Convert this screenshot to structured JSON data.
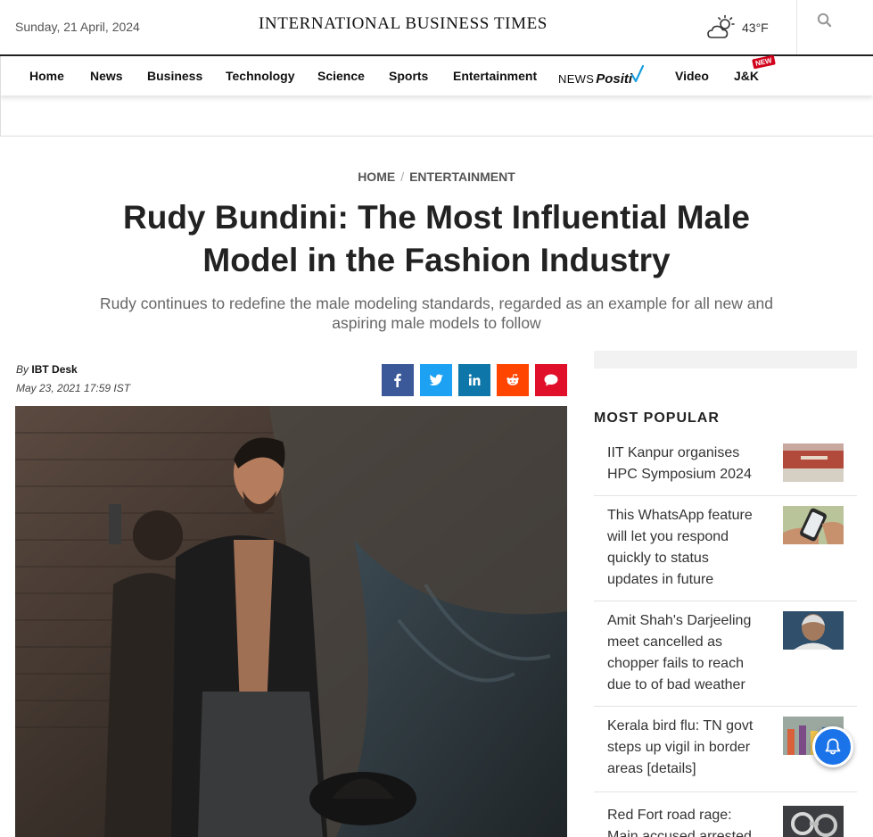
{
  "header": {
    "date": "Sunday, 21 April, 2024",
    "brand": "INTERNATIONAL BUSINESS TIMES",
    "weather_icon": "cloud-sun-icon",
    "temperature": "43°F",
    "search_icon": "search-icon"
  },
  "nav": {
    "items": [
      "Home",
      "News",
      "Business",
      "Technology",
      "Science",
      "Sports",
      "Entertainment"
    ],
    "newspositiv_prefix": "NEWS",
    "newspositiv_word": "Positi",
    "video": "Video",
    "jk": "J&K",
    "new_badge": "NEW"
  },
  "breadcrumb": {
    "home": "HOME",
    "separator": "/",
    "section": "ENTERTAINMENT"
  },
  "article": {
    "title": "Rudy Bundini: The Most Influential Male Model in the Fashion Industry",
    "subtitle": "Rudy continues to redefine the male modeling standards, regarded as an example for all new and aspiring male models to follow",
    "by_label": "By",
    "author": "IBT Desk",
    "date": "May 23, 2021 17:59 IST"
  },
  "share": {
    "facebook_color": "#3b5998",
    "twitter_color": "#1da1f2",
    "linkedin_color": "#0e76a8",
    "reddit_color": "#ff4500",
    "comment_color": "#e0102b"
  },
  "sidebar": {
    "most_popular_heading": "MOST POPULAR",
    "items": [
      {
        "title": "IIT Kanpur organises HPC Symposium 2024"
      },
      {
        "title": "This WhatsApp feature will let you respond quickly to status updates in future"
      },
      {
        "title": "Amit Shah's Darjeeling meet cancelled as chopper fails to reach due to of bad weather"
      },
      {
        "title": "Kerala bird flu: TN govt steps up vigil in border areas [details]"
      },
      {
        "title": "Red Fort road rage: Main accused arrested"
      }
    ]
  },
  "notification_icon": "bell-icon"
}
